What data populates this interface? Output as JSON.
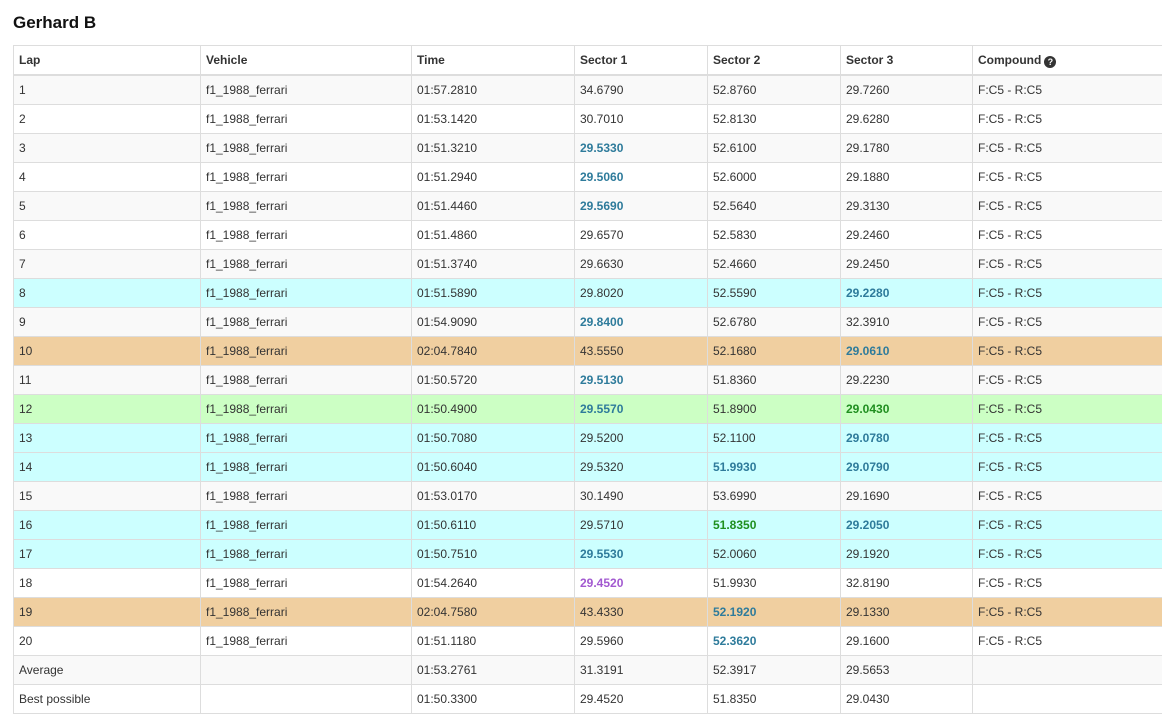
{
  "page": {
    "title": "Gerhard B"
  },
  "columns": [
    "Lap",
    "Vehicle",
    "Time",
    "Sector 1",
    "Sector 2",
    "Sector 3",
    "Compound"
  ],
  "compound_help_icon": "question-circle-icon",
  "colors": {
    "row_cyan": "#ccffff",
    "row_orange": "#f0cfa0",
    "row_green": "#ccffc4",
    "sector_blue": "#2e7b9b",
    "sector_green": "#1f8f1f",
    "sector_purple": "#a259d0"
  },
  "laps": [
    {
      "lap": "1",
      "vehicle": "f1_1988_ferrari",
      "time": "01:57.2810",
      "s1": "34.6790",
      "s2": "52.8760",
      "s3": "29.7260",
      "compound": "F:C5 - R:C5",
      "row": "",
      "s1c": "",
      "s2c": "",
      "s3c": ""
    },
    {
      "lap": "2",
      "vehicle": "f1_1988_ferrari",
      "time": "01:53.1420",
      "s1": "30.7010",
      "s2": "52.8130",
      "s3": "29.6280",
      "compound": "F:C5 - R:C5",
      "row": "",
      "s1c": "",
      "s2c": "",
      "s3c": ""
    },
    {
      "lap": "3",
      "vehicle": "f1_1988_ferrari",
      "time": "01:51.3210",
      "s1": "29.5330",
      "s2": "52.6100",
      "s3": "29.1780",
      "compound": "F:C5 - R:C5",
      "row": "",
      "s1c": "blue",
      "s2c": "",
      "s3c": ""
    },
    {
      "lap": "4",
      "vehicle": "f1_1988_ferrari",
      "time": "01:51.2940",
      "s1": "29.5060",
      "s2": "52.6000",
      "s3": "29.1880",
      "compound": "F:C5 - R:C5",
      "row": "",
      "s1c": "blue",
      "s2c": "",
      "s3c": ""
    },
    {
      "lap": "5",
      "vehicle": "f1_1988_ferrari",
      "time": "01:51.4460",
      "s1": "29.5690",
      "s2": "52.5640",
      "s3": "29.3130",
      "compound": "F:C5 - R:C5",
      "row": "",
      "s1c": "blue",
      "s2c": "",
      "s3c": ""
    },
    {
      "lap": "6",
      "vehicle": "f1_1988_ferrari",
      "time": "01:51.4860",
      "s1": "29.6570",
      "s2": "52.5830",
      "s3": "29.2460",
      "compound": "F:C5 - R:C5",
      "row": "",
      "s1c": "",
      "s2c": "",
      "s3c": ""
    },
    {
      "lap": "7",
      "vehicle": "f1_1988_ferrari",
      "time": "01:51.3740",
      "s1": "29.6630",
      "s2": "52.4660",
      "s3": "29.2450",
      "compound": "F:C5 - R:C5",
      "row": "",
      "s1c": "",
      "s2c": "",
      "s3c": ""
    },
    {
      "lap": "8",
      "vehicle": "f1_1988_ferrari",
      "time": "01:51.5890",
      "s1": "29.8020",
      "s2": "52.5590",
      "s3": "29.2280",
      "compound": "F:C5 - R:C5",
      "row": "cyan",
      "s1c": "",
      "s2c": "",
      "s3c": "blue"
    },
    {
      "lap": "9",
      "vehicle": "f1_1988_ferrari",
      "time": "01:54.9090",
      "s1": "29.8400",
      "s2": "52.6780",
      "s3": "32.3910",
      "compound": "F:C5 - R:C5",
      "row": "",
      "s1c": "blue",
      "s2c": "",
      "s3c": ""
    },
    {
      "lap": "10",
      "vehicle": "f1_1988_ferrari",
      "time": "02:04.7840",
      "s1": "43.5550",
      "s2": "52.1680",
      "s3": "29.0610",
      "compound": "F:C5 - R:C5",
      "row": "orange",
      "s1c": "",
      "s2c": "",
      "s3c": "blue"
    },
    {
      "lap": "11",
      "vehicle": "f1_1988_ferrari",
      "time": "01:50.5720",
      "s1": "29.5130",
      "s2": "51.8360",
      "s3": "29.2230",
      "compound": "F:C5 - R:C5",
      "row": "",
      "s1c": "blue",
      "s2c": "",
      "s3c": ""
    },
    {
      "lap": "12",
      "vehicle": "f1_1988_ferrari",
      "time": "01:50.4900",
      "s1": "29.5570",
      "s2": "51.8900",
      "s3": "29.0430",
      "compound": "F:C5 - R:C5",
      "row": "green",
      "s1c": "blue",
      "s2c": "",
      "s3c": "green"
    },
    {
      "lap": "13",
      "vehicle": "f1_1988_ferrari",
      "time": "01:50.7080",
      "s1": "29.5200",
      "s2": "52.1100",
      "s3": "29.0780",
      "compound": "F:C5 - R:C5",
      "row": "cyan",
      "s1c": "",
      "s2c": "",
      "s3c": "blue"
    },
    {
      "lap": "14",
      "vehicle": "f1_1988_ferrari",
      "time": "01:50.6040",
      "s1": "29.5320",
      "s2": "51.9930",
      "s3": "29.0790",
      "compound": "F:C5 - R:C5",
      "row": "cyan",
      "s1c": "",
      "s2c": "blue",
      "s3c": "blue"
    },
    {
      "lap": "15",
      "vehicle": "f1_1988_ferrari",
      "time": "01:53.0170",
      "s1": "30.1490",
      "s2": "53.6990",
      "s3": "29.1690",
      "compound": "F:C5 - R:C5",
      "row": "",
      "s1c": "",
      "s2c": "",
      "s3c": ""
    },
    {
      "lap": "16",
      "vehicle": "f1_1988_ferrari",
      "time": "01:50.6110",
      "s1": "29.5710",
      "s2": "51.8350",
      "s3": "29.2050",
      "compound": "F:C5 - R:C5",
      "row": "cyan",
      "s1c": "",
      "s2c": "green",
      "s3c": "blue"
    },
    {
      "lap": "17",
      "vehicle": "f1_1988_ferrari",
      "time": "01:50.7510",
      "s1": "29.5530",
      "s2": "52.0060",
      "s3": "29.1920",
      "compound": "F:C5 - R:C5",
      "row": "cyan",
      "s1c": "blue",
      "s2c": "",
      "s3c": ""
    },
    {
      "lap": "18",
      "vehicle": "f1_1988_ferrari",
      "time": "01:54.2640",
      "s1": "29.4520",
      "s2": "51.9930",
      "s3": "32.8190",
      "compound": "F:C5 - R:C5",
      "row": "",
      "s1c": "purple",
      "s2c": "",
      "s3c": ""
    },
    {
      "lap": "19",
      "vehicle": "f1_1988_ferrari",
      "time": "02:04.7580",
      "s1": "43.4330",
      "s2": "52.1920",
      "s3": "29.1330",
      "compound": "F:C5 - R:C5",
      "row": "orange",
      "s1c": "",
      "s2c": "blue",
      "s3c": ""
    },
    {
      "lap": "20",
      "vehicle": "f1_1988_ferrari",
      "time": "01:51.1180",
      "s1": "29.5960",
      "s2": "52.3620",
      "s3": "29.1600",
      "compound": "F:C5 - R:C5",
      "row": "",
      "s1c": "",
      "s2c": "blue",
      "s3c": ""
    }
  ],
  "summary": [
    {
      "lap": "Average",
      "vehicle": "",
      "time": "01:53.2761",
      "s1": "31.3191",
      "s2": "52.3917",
      "s3": "29.5653",
      "compound": ""
    },
    {
      "lap": "Best possible",
      "vehicle": "",
      "time": "01:50.3300",
      "s1": "29.4520",
      "s2": "51.8350",
      "s3": "29.0430",
      "compound": ""
    }
  ]
}
